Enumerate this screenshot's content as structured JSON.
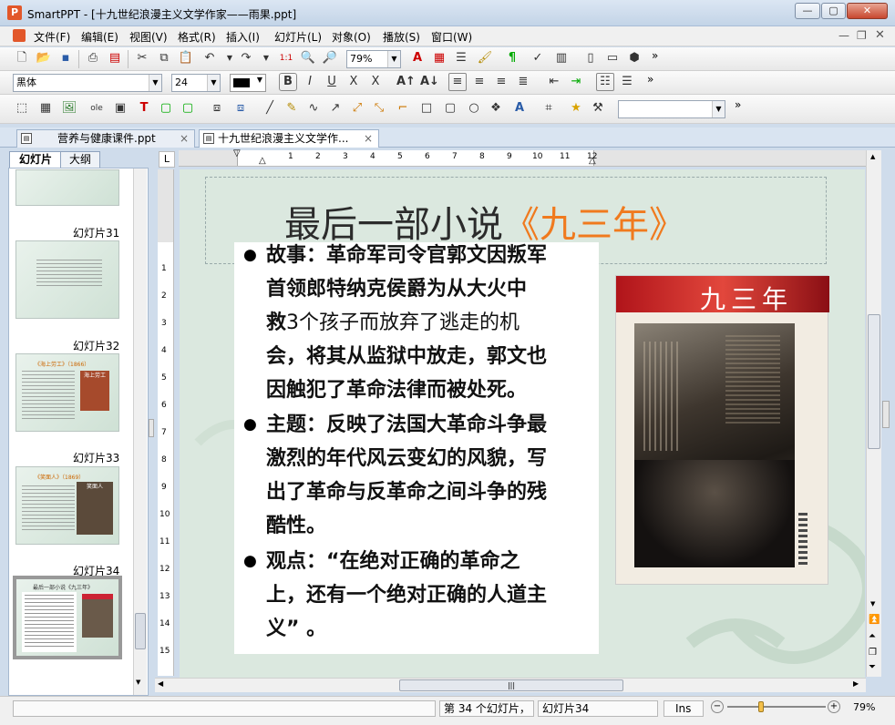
{
  "window": {
    "title": "SmartPPT - [十九世纪浪漫主义文学作家——雨果.ppt]",
    "app_icon_letter": "P"
  },
  "menu": [
    "文件(F)",
    "编辑(E)",
    "视图(V)",
    "格式(R)",
    "插入(I)",
    "幻灯片(L)",
    "对象(O)",
    "播放(S)",
    "窗口(W)"
  ],
  "toolbar1": {
    "zoom": "79%"
  },
  "toolbar2": {
    "font_name": "黑体",
    "font_size": "24",
    "bold": "B",
    "italic": "I",
    "underline": "U",
    "strike": "X",
    "shadow": "X"
  },
  "tabs": [
    {
      "label": "营养与健康课件.ppt",
      "close": "×"
    },
    {
      "label": "十九世纪浪漫主义文学作...",
      "close": "×"
    }
  ],
  "panel_tabs": {
    "slides": "幻灯片",
    "outline": "大纲"
  },
  "thumbnails": [
    {
      "label": "幻灯片31"
    },
    {
      "label": "幻灯片32",
      "title": "《海上劳工》（1866）",
      "book_label": "海上劳工"
    },
    {
      "label": "幻灯片33",
      "title": "《笑面人》（1869）",
      "book_label": "笑面人"
    },
    {
      "label": "幻灯片34",
      "title": "最后一部小说《九三年》"
    }
  ],
  "ruler_h": [
    "1",
    "2",
    "3",
    "4",
    "5",
    "6",
    "7",
    "8",
    "9",
    "10",
    "11",
    "12"
  ],
  "ruler_v": [
    "1",
    "2",
    "3",
    "4",
    "5",
    "6",
    "7",
    "8",
    "9",
    "10",
    "11",
    "12",
    "13",
    "14",
    "15"
  ],
  "slide": {
    "title_main": "最后一部小说",
    "title_highlight": "《九三年》",
    "bullets": [
      {
        "lines": [
          [
            {
              "t": "故事：革命军司令官郭文因叛军",
              "b": true
            }
          ],
          [
            {
              "t": "首领郎特纳克侯爵为从大火中",
              "b": true
            }
          ],
          [
            {
              "t": "救",
              "b": true
            },
            {
              "t": "3个孩子而放弃了逃走的机",
              "b": false
            }
          ],
          [
            {
              "t": "会，将其从监狱中放走，郭文也",
              "b": true
            }
          ],
          [
            {
              "t": "因触犯了革命法律而被处死。",
              "b": true
            }
          ]
        ]
      },
      {
        "lines": [
          [
            {
              "t": "主题：反映了法国大革命斗争最",
              "b": true
            }
          ],
          [
            {
              "t": "激烈的年代风云变幻的风貌，写",
              "b": true
            }
          ],
          [
            {
              "t": "出了革命与反革命之间斗争的残",
              "b": true
            }
          ],
          [
            {
              "t": "酷性。",
              "b": true
            }
          ]
        ]
      },
      {
        "lines": [
          [
            {
              "t": "观点：“在绝对正确的革命之",
              "b": true
            }
          ],
          [
            {
              "t": "上，还有一个绝对正确的人道主",
              "b": true
            }
          ],
          [
            {
              "t": "义” 。",
              "b": true
            }
          ]
        ]
      }
    ],
    "book_cover_title": "九三年"
  },
  "status": {
    "slide_count": "第 34 个幻灯片，",
    "slide_name": "幻灯片34",
    "ins": "Ins",
    "zoom": "79%"
  }
}
